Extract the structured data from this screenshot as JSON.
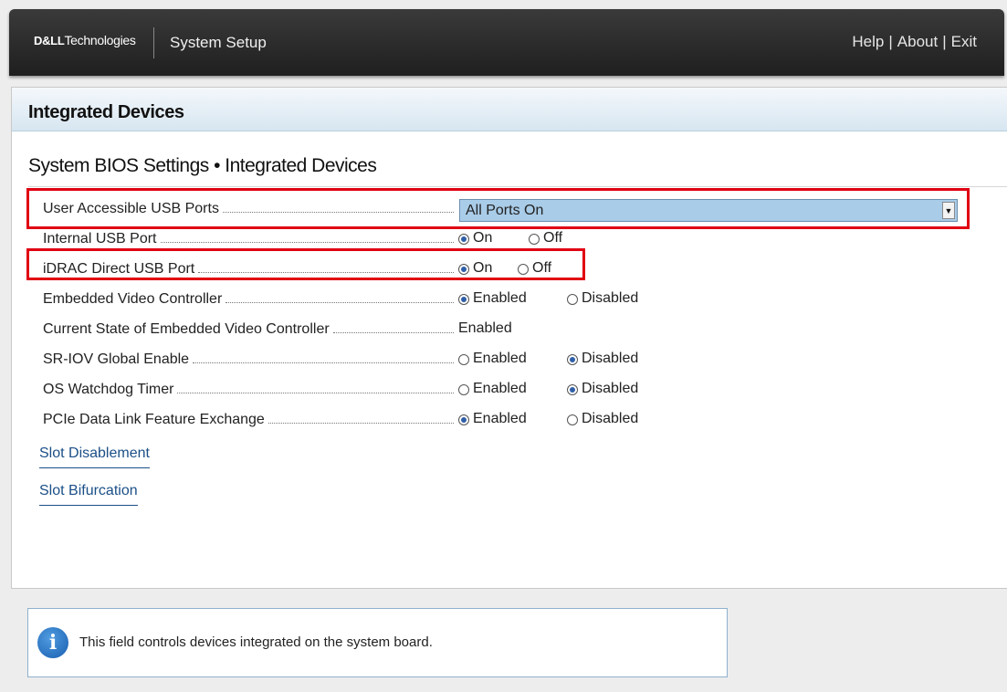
{
  "topbar": {
    "brand_mark": "D&LL",
    "brand_text": "Technologies",
    "app_title": "System Setup",
    "links": [
      "Help",
      "About",
      "Exit"
    ],
    "separator": "|"
  },
  "panel": {
    "header": "Integrated Devices",
    "section_title": "System BIOS Settings • Integrated Devices"
  },
  "settings": [
    {
      "label": "User Accessible USB Ports",
      "type": "select",
      "value": "All Ports On"
    },
    {
      "label": "Internal USB Port",
      "type": "radio",
      "options": [
        "On",
        "Off"
      ],
      "selected": 0
    },
    {
      "label": "iDRAC Direct USB Port",
      "type": "radio",
      "options": [
        "On",
        "Off"
      ],
      "selected": 0
    },
    {
      "label": "Embedded Video Controller",
      "type": "radio",
      "options": [
        "Enabled",
        "Disabled"
      ],
      "selected": 0
    },
    {
      "label": "Current State of Embedded Video Controller",
      "type": "static",
      "value": "Enabled"
    },
    {
      "label": "SR-IOV Global Enable",
      "type": "radio",
      "options": [
        "Enabled",
        "Disabled"
      ],
      "selected": 1
    },
    {
      "label": "OS Watchdog Timer",
      "type": "radio",
      "options": [
        "Enabled",
        "Disabled"
      ],
      "selected": 1
    },
    {
      "label": "PCIe Data Link Feature Exchange",
      "type": "radio",
      "options": [
        "Enabled",
        "Disabled"
      ],
      "selected": 0
    }
  ],
  "links": [
    "Slot Disablement",
    "Slot Bifurcation"
  ],
  "info": {
    "icon": "info-icon",
    "text": "This field controls devices integrated on the system board."
  },
  "colors": {
    "highlight": "#e00012",
    "radio_dot": "#2f5fa8",
    "select_bg": "#a9cce8",
    "link": "#1b4f87"
  }
}
